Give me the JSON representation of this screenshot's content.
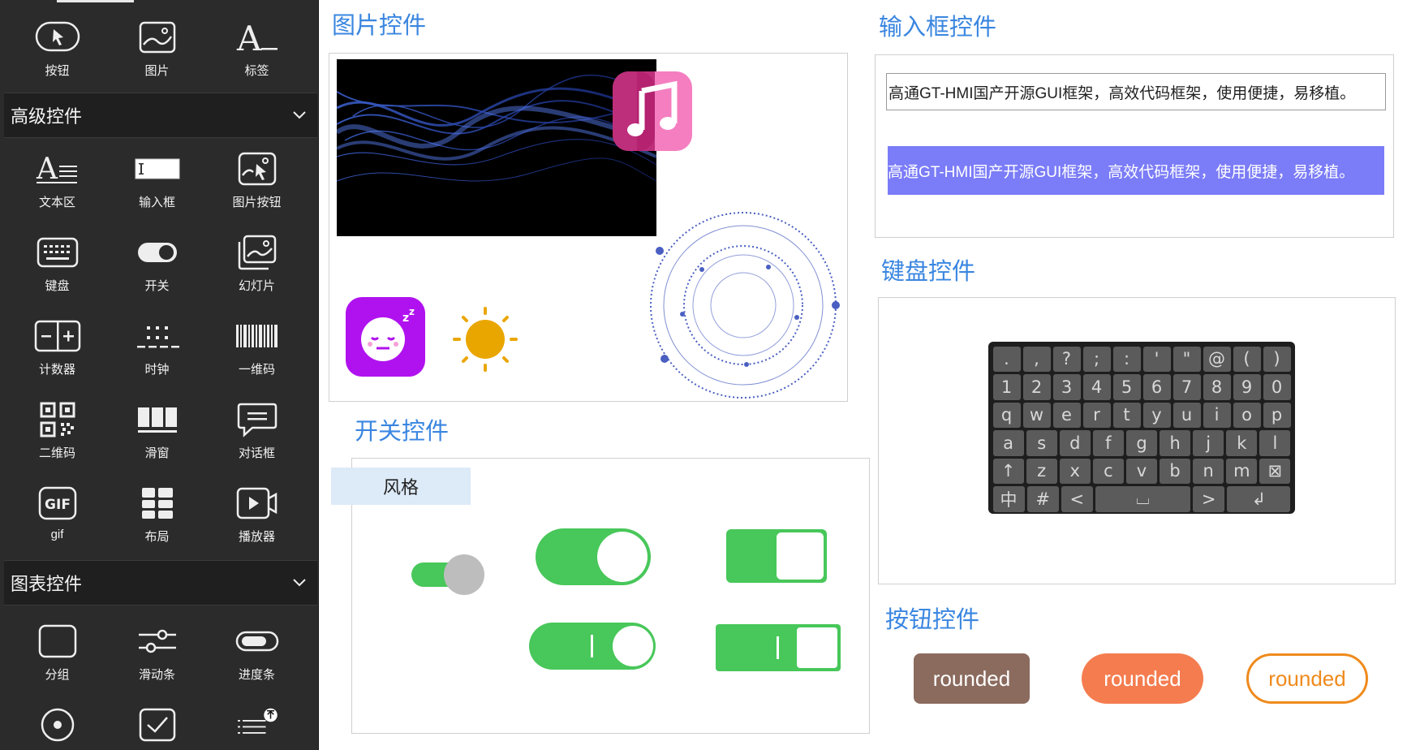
{
  "sidebar": {
    "basic_items": [
      {
        "label": "按钮",
        "icon": "pointer-button-icon"
      },
      {
        "label": "图片",
        "icon": "image-icon"
      },
      {
        "label": "标签",
        "icon": "label-text-icon"
      }
    ],
    "advanced_header": "高级控件",
    "advanced_items": [
      {
        "label": "文本区",
        "icon": "text-area-icon"
      },
      {
        "label": "输入框",
        "icon": "input-box-icon"
      },
      {
        "label": "图片按钮",
        "icon": "image-button-icon"
      },
      {
        "label": "键盘",
        "icon": "keyboard-icon"
      },
      {
        "label": "开关",
        "icon": "toggle-icon"
      },
      {
        "label": "幻灯片",
        "icon": "slideshow-icon"
      },
      {
        "label": "计数器",
        "icon": "counter-icon"
      },
      {
        "label": "时钟",
        "icon": "clock-icon"
      },
      {
        "label": "一维码",
        "icon": "barcode-icon"
      },
      {
        "label": "二维码",
        "icon": "qrcode-icon"
      },
      {
        "label": "滑窗",
        "icon": "sliding-window-icon"
      },
      {
        "label": "对话框",
        "icon": "dialog-icon"
      },
      {
        "label": "gif",
        "icon": "gif-icon"
      },
      {
        "label": "布局",
        "icon": "layout-icon"
      },
      {
        "label": "播放器",
        "icon": "player-icon"
      }
    ],
    "chart_header": "图表控件",
    "chart_items": [
      {
        "label": "分组",
        "icon": "group-icon"
      },
      {
        "label": "滑动条",
        "icon": "slider-icon"
      },
      {
        "label": "进度条",
        "icon": "progress-bar-icon"
      },
      {
        "label": "",
        "icon": "radio-icon"
      },
      {
        "label": "",
        "icon": "checkbox-icon"
      },
      {
        "label": "",
        "icon": "list-icon"
      }
    ]
  },
  "main": {
    "image_section_title": "图片控件",
    "input_section_title": "输入框控件",
    "input_value_1": "高通GT-HMI国产开源GUI框架，高效代码框架，使用便捷，易移植。",
    "input_value_2": "高通GT-HMI国产开源GUI框架，高效代码框架，使用便捷，易移植。",
    "keyboard_section_title": "键盘控件",
    "switch_section_title": "开关控件",
    "switch_style_tab": "风格",
    "button_section_title": "按钮控件",
    "buttons": [
      "rounded",
      "rounded",
      "rounded"
    ]
  },
  "keyboard": {
    "rows": [
      [
        ".",
        ",",
        "?",
        ";",
        ":",
        "'",
        "\"",
        "@",
        "(",
        ")"
      ],
      [
        "1",
        "2",
        "3",
        "4",
        "5",
        "6",
        "7",
        "8",
        "9",
        "0"
      ],
      [
        "q",
        "w",
        "e",
        "r",
        "t",
        "y",
        "u",
        "i",
        "o",
        "p"
      ],
      [
        "a",
        "s",
        "d",
        "f",
        "g",
        "h",
        "j",
        "k",
        "l"
      ],
      [
        "↑",
        "z",
        "x",
        "c",
        "v",
        "b",
        "n",
        "m",
        "⊠"
      ],
      [
        "中",
        "#",
        "<",
        "⌴",
        ">",
        "↲"
      ]
    ]
  },
  "colors": {
    "accent_title": "#3a86e0",
    "sidebar_bg": "#2b2b2b",
    "toggle_green": "#48c75a",
    "input_highlight": "#7b7cf7",
    "btn_brown": "#8b6b5e",
    "btn_orange": "#f47c4f",
    "btn_outline": "#ef8a1c"
  }
}
